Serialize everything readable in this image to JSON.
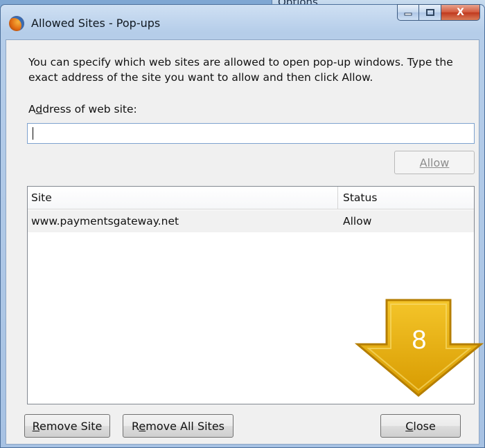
{
  "background_window": {
    "title": "Options"
  },
  "dialog": {
    "title": "Allowed Sites - Pop-ups",
    "app_icon": "firefox-icon",
    "caption_buttons": {
      "minimize": "minimize-icon",
      "maximize": "maximize-icon",
      "close": "close-icon",
      "close_glyph": "X"
    },
    "description": "You can specify which web sites are allowed to open pop-up windows. Type the exact address of the site you want to allow and then click Allow.",
    "address_label": "Address of web site:",
    "address_value": "",
    "allow_label": "Allow",
    "list": {
      "columns": [
        "Site",
        "Status"
      ],
      "rows": [
        {
          "site": "www.paymentsgateway.net",
          "status": "Allow"
        }
      ]
    },
    "remove_site_label": "Remove Site",
    "remove_all_label": "Remove All Sites",
    "close_label": "Close"
  },
  "annotation": {
    "step_number": "8",
    "color": "#e8a800"
  }
}
